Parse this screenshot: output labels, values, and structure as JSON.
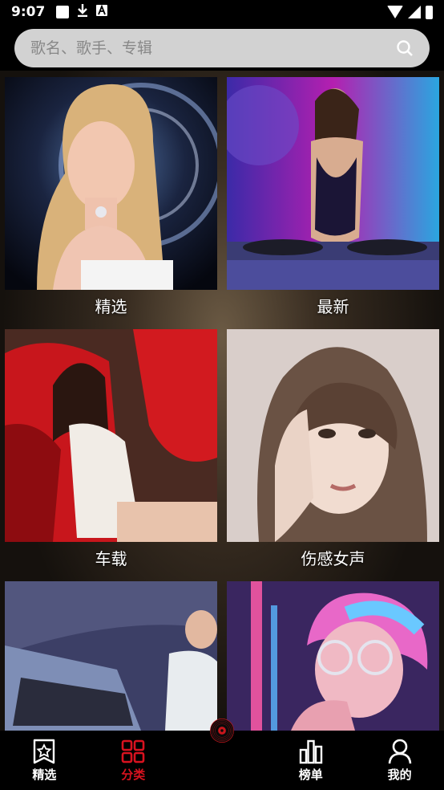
{
  "status_bar": {
    "time": "9:07"
  },
  "search": {
    "placeholder": "歌名、歌手、专辑"
  },
  "categories": [
    {
      "label": "精选",
      "image": "blonde-woman-portrait"
    },
    {
      "label": "最新",
      "image": "dj-woman-turntables"
    },
    {
      "label": "车载",
      "image": "woman-in-red-car"
    },
    {
      "label": "伤感女声",
      "image": "crying-woman-illustration"
    },
    {
      "label": "",
      "image": "dj-mixing-console"
    },
    {
      "label": "",
      "image": "neon-girl-glasses"
    }
  ],
  "tabbar": {
    "tabs": [
      {
        "label": "精选",
        "icon": "star-bookmark-icon",
        "active": false
      },
      {
        "label": "分类",
        "icon": "grid-icon",
        "active": true
      },
      {
        "label": "",
        "icon": "vinyl-disc-icon",
        "active": false
      },
      {
        "label": "榜单",
        "icon": "bar-chart-icon",
        "active": false
      },
      {
        "label": "我的",
        "icon": "user-icon",
        "active": false
      }
    ]
  },
  "colors": {
    "accent": "#d8121f",
    "search_bg": "#d2d2d2"
  }
}
